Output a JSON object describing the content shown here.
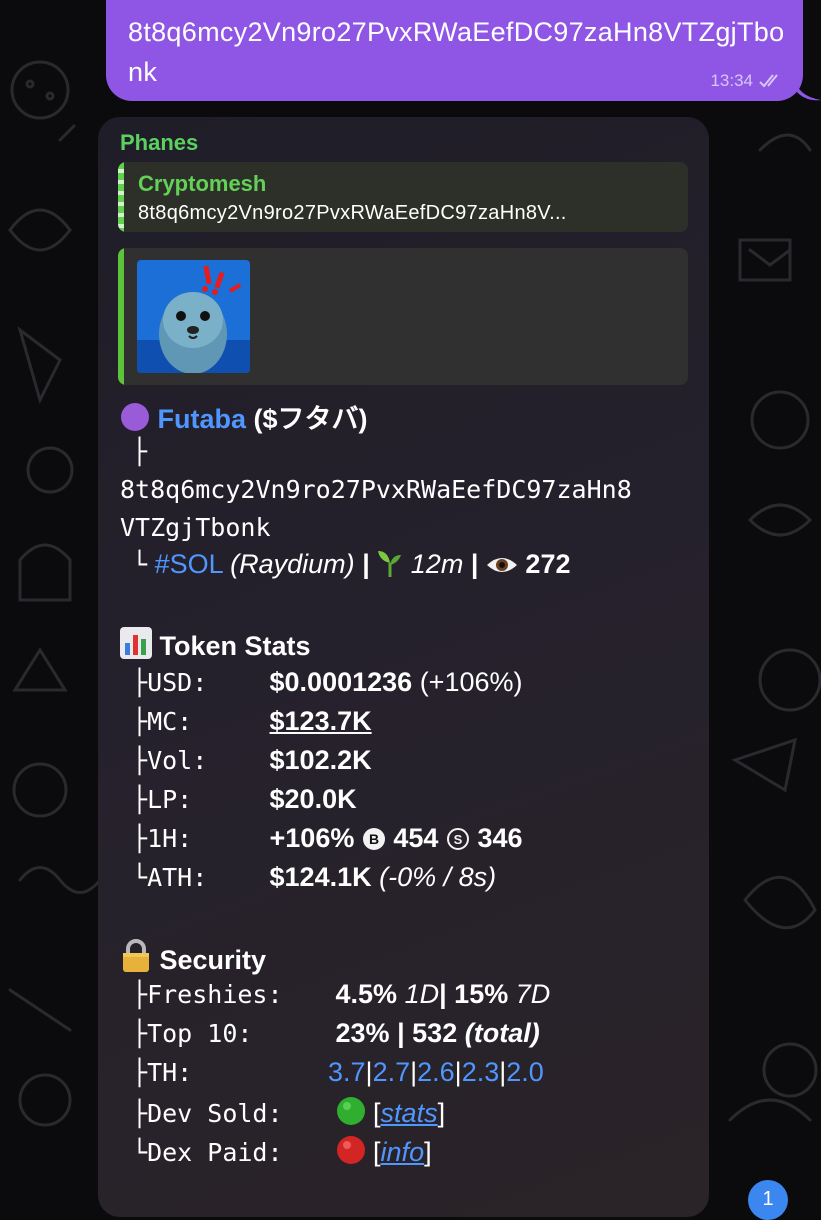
{
  "outgoing": {
    "text": "8t8q6mcy2Vn9ro27PvxRWaEefDC97zaHn8VTZgjTbonk",
    "time": "13:34",
    "status_icon": "double-check-icon"
  },
  "incoming": {
    "sender": "Phanes",
    "reply": {
      "name": "Cryptomesh",
      "text": "8t8q6mcy2Vn9ro27PvxRWaEefDC97zaHn8V..."
    },
    "token": {
      "emoji": "purple-circle-icon",
      "name": "Futaba",
      "symbol": "($フタバ)",
      "tree_branch": "├",
      "address_line1": "8t8q6mcy2Vn9ro27PvxRWaEefDC97zaHn8",
      "address_line2": "VTZgjTbonk",
      "tree_end": "└",
      "chain": "#SOL",
      "dex": "(Raydium)",
      "sep": "|",
      "age": "12m",
      "views": "272"
    },
    "stats": {
      "title": "Token Stats",
      "rows": [
        {
          "branch": "├",
          "label": "USD:",
          "value": "$0.0001236",
          "extra": "(+106%)"
        },
        {
          "branch": "├",
          "label": "MC:",
          "value": "$123.7K"
        },
        {
          "branch": "├",
          "label": "Vol:",
          "value": "$102.2K"
        },
        {
          "branch": "├",
          "label": "LP:",
          "value": "$20.0K"
        },
        {
          "branch": "├",
          "label": "1H:",
          "value": "+106%",
          "buys": "454",
          "sells": "346"
        },
        {
          "branch": "└",
          "label": "ATH:",
          "value": "$124.1K",
          "extra": "(-0% / 8s)"
        }
      ]
    },
    "security": {
      "title": "Security",
      "freshies": {
        "branch": "├",
        "label": "Freshies:",
        "v1": "4.5%",
        "p1": "1D",
        "sep": "|",
        "v2": "15%",
        "p2": "7D"
      },
      "top10": {
        "branch": "├",
        "label": "Top 10:",
        "v1": "23%",
        "sep": "|",
        "v2": "532",
        "p2": "(total)"
      },
      "th": {
        "branch": "├",
        "label": "TH:",
        "values": [
          "3.7",
          "2.7",
          "2.6",
          "2.3",
          "2.0"
        ],
        "sep": "|"
      },
      "dev_sold": {
        "branch": "├",
        "label": "Dev Sold:",
        "status": "green-circle-icon",
        "open": "[",
        "link": "stats",
        "close": "]"
      },
      "dex_paid": {
        "branch": "└",
        "label": "Dex Paid:",
        "status": "red-circle-icon",
        "open": "[",
        "link": "info",
        "close": "]"
      }
    }
  },
  "unread_badge": "1",
  "colors": {
    "outgoing_bubble": "#8f56e6",
    "sender_name": "#5bd160",
    "link": "#4f96ff",
    "badge": "#3b86ef"
  }
}
